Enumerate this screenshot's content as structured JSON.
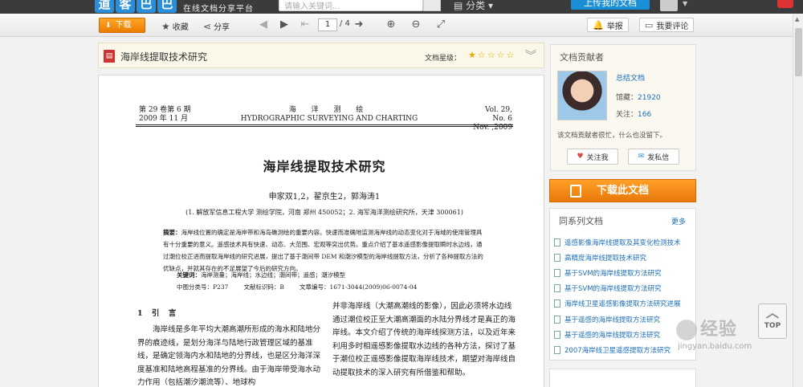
{
  "header": {
    "logo_chars": [
      "道",
      "客",
      "巴",
      "巴"
    ],
    "logo_subtitle": "在线文档分享平台",
    "search_placeholder": "请输入关键词...",
    "category_label": "分类",
    "upload_label": "上传我的文档"
  },
  "toolbar": {
    "download_label": "下载",
    "favorite_label": "收藏",
    "share_label": "分享",
    "page_current": "1",
    "page_total": "/ 4",
    "report_label": "举报",
    "comment_label": "我要评论"
  },
  "document": {
    "title": "海岸线提取技术研究",
    "rating_label": "文档星级：",
    "rating_stars": 1,
    "rating_max": 5
  },
  "paper": {
    "vol_left_1": "第 29 卷第 6 期",
    "vol_left_2": "2009 年 11 月",
    "journal_cn": "海 洋 测 绘",
    "journal_en": "HYDROGRAPHIC SURVEYING AND CHARTING",
    "vol_right_1": "Vol. 29, No. 6",
    "vol_right_2": "Nov. ,2009",
    "title": "海岸线提取技术研究",
    "authors": "申家双1,2，翟京生2，郭海涛1",
    "affiliation": "(1. 解放军信息工程大学 测绘学院，河南 郑州  450052；2. 海军海洋测绘研究所，天津  300061)",
    "abstract_label": "摘要：",
    "abstract_text": "海岸线位置的确定是海岸带和海岛礁测绘的重要内容。快速而准确地监测海岸线的动态变化对于海域的使用管理具有十分重要的意义。遥感技术具有快速、动态、大范围、宏观等突出优势。重点介绍了基本遥感影像提取瞬时水边线，通过潮位校正进而提取海岸线的研究进展，提出了基于潮间带 DEM 和潮汐模型的海岸线提取方法，分析了各种提取方法的优缺点，并就其存在的不足展望了今后的研究方向。",
    "keywords_label": "关键词：",
    "keywords_text": "海岸测量；海岸线；水边线；潮间带；遥感；潮汐模型",
    "classification": "中图分类号：P237        文献标识码：B        文章编号：1671-3044(2009)06-0074-04",
    "section_heading": "1 引 言",
    "col1_text": "海岸线是多年平均大潮高潮所形成的海水和陆地分界的痕迹线，是划分海洋与陆地行政管理区域的基准线，是确定领海内水和陆地的分界线，也是区分海洋深度基准和陆地高程基准的分界线。由于海岸带受海水动力作用（包括潮汐潮流等）、地球构",
    "col2_text": "并非海岸线（大潮高潮线的影像），因此必须将水边线通过潮位校正至大潮高潮面的水陆分界线才是真正的海岸线。本文介绍了传统的海岸线探测方法，以及近年来利用多时相遥感影像提取水边线的各种方法，探讨了基于潮位校正遥感影像提取海岸线技术，期望对海岸线自动提取技术的深入研究有所借鉴和帮助。"
  },
  "contributor": {
    "section_title": "文档贡献者",
    "name": "总结文档",
    "downloads_label": "馆藏：",
    "downloads_value": "21920",
    "follow_label": "关注：",
    "follow_value": "166",
    "description": "该文档贡献者很忙，什么也没留下。",
    "follow_btn": "关注我",
    "message_btn": "发私信"
  },
  "download_big": "下载此文档",
  "related": {
    "title": "同系列文档",
    "more": "更多",
    "items": [
      "遥感影像海岸线提取及其变化检测技术",
      "高精度海岸线提取技术研究",
      "基于SVM的海岸线提取方法研究",
      "基于SVM的海岸线提取方法研究",
      "海岸线卫星遥感影像提取方法研究进展",
      "基于遥感的海岸线提取方法研究",
      "基于遥感的海岸线提取方法研究",
      "2007海岸线卫星遥感提取方法研究"
    ]
  },
  "top_label": "TOP",
  "watermark": {
    "brand": "经验",
    "url": "jingyan.baidu.com"
  },
  "colors": {
    "accent_orange": "#ea7d00",
    "link_blue": "#1d6fb8",
    "topbar": "#3b3b3b"
  }
}
